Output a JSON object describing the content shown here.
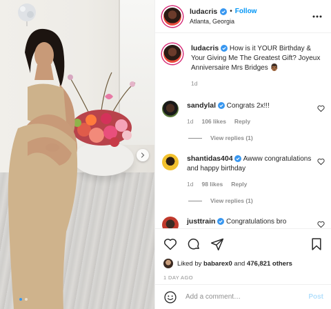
{
  "media": {
    "active_slide": 1,
    "slide_count": 2
  },
  "post": {
    "author": "ludacris",
    "follow_label": "Follow",
    "separator": "•",
    "location": "Atlanta, Georgia",
    "caption": "How is it YOUR Birthday & Your Giving Me The Greatest Gift? Joyeux Anniversaire Mrs Bridges 👨🏾",
    "caption_age": "1d"
  },
  "comments": [
    {
      "username": "sandylal",
      "text": "Congrats 2x!!!",
      "age": "1d",
      "likes": "106 likes",
      "reply_label": "Reply",
      "view_replies": "View replies (1)"
    },
    {
      "username": "shantidas404",
      "text": "Awww congratulations and happy birthday",
      "age": "1d",
      "likes": "98 likes",
      "reply_label": "Reply",
      "view_replies": "View replies (1)"
    },
    {
      "username": "justtrain",
      "text": "Congratulations bro"
    }
  ],
  "engagement": {
    "liked_prefix": "Liked by",
    "liked_user": "babarex0",
    "and_label": "and",
    "others_label": "476,821 others",
    "timestamp": "1 DAY AGO"
  },
  "composer": {
    "placeholder": "Add a comment…",
    "post_label": "Post"
  },
  "icons": {
    "verified": "verified-badge-icon",
    "more": "more-options-icon",
    "like": "heart-icon",
    "comment": "comment-icon",
    "share": "share-icon",
    "save": "bookmark-icon",
    "emoji": "emoji-icon",
    "next": "chevron-right-icon"
  },
  "colors": {
    "link_blue": "#0095f6",
    "post_disabled": "#b2dffc",
    "muted": "#8e8e8e",
    "text": "#262626"
  }
}
